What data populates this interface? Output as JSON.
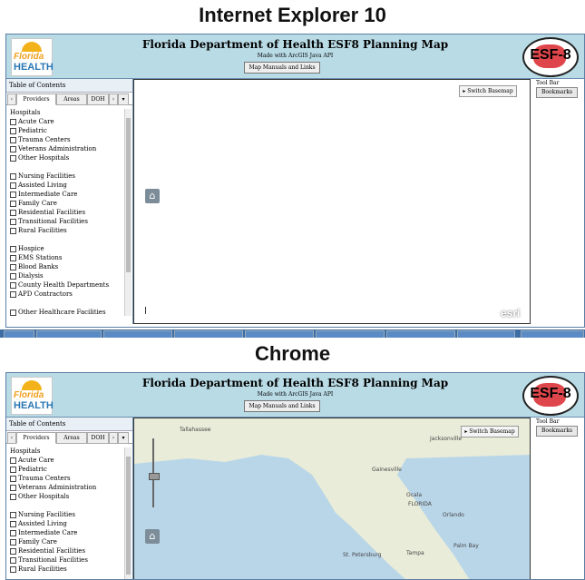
{
  "headings": {
    "ie": "Internet Explorer 10",
    "chrome": "Chrome"
  },
  "app": {
    "title": "Florida Department of Health ESF8 Planning Map",
    "subtitle": "Made with ArcGIS Java API",
    "manuals_button": "Map Manuals and Links",
    "logo_florida": "Florida",
    "logo_health": "HEALTH",
    "esf_logo": "ESF-8"
  },
  "toc": {
    "header": "Table of Contents",
    "tabs": [
      "Providers",
      "Areas",
      "DOH"
    ],
    "group_title": "Hospitals",
    "hospitals": [
      "Acute Care",
      "Pediatric",
      "Trauma Centers",
      "Veterans Administration",
      "Other Hospitals"
    ],
    "facilities": [
      "Nursing Facilities",
      "Assisted Living",
      "Intermediate Care",
      "Family Care",
      "Residential Facilities",
      "Transitional Facilities",
      "Rural Facilities"
    ],
    "services": [
      "Hospice",
      "EMS Stations",
      "Blood Banks",
      "Dialysis",
      "County Health Departments",
      "APD Contractors"
    ],
    "other": "Other Healthcare Facilities"
  },
  "map": {
    "switch_basemap": "Switch Basemap",
    "esri": "esri",
    "place_labels": [
      "Tallahassee",
      "Jacksonville",
      "Gainesville",
      "Ocala",
      "FLORIDA",
      "Orlando",
      "Tampa",
      "Palm Bay",
      "St. Petersburg"
    ]
  },
  "toolbar": {
    "label": "Tool Bar",
    "bookmarks": "Bookmarks"
  },
  "colors": {
    "header_bg": "#b9dbe6",
    "border": "#5b7fa3",
    "taskbar": "#3c6ea5"
  }
}
